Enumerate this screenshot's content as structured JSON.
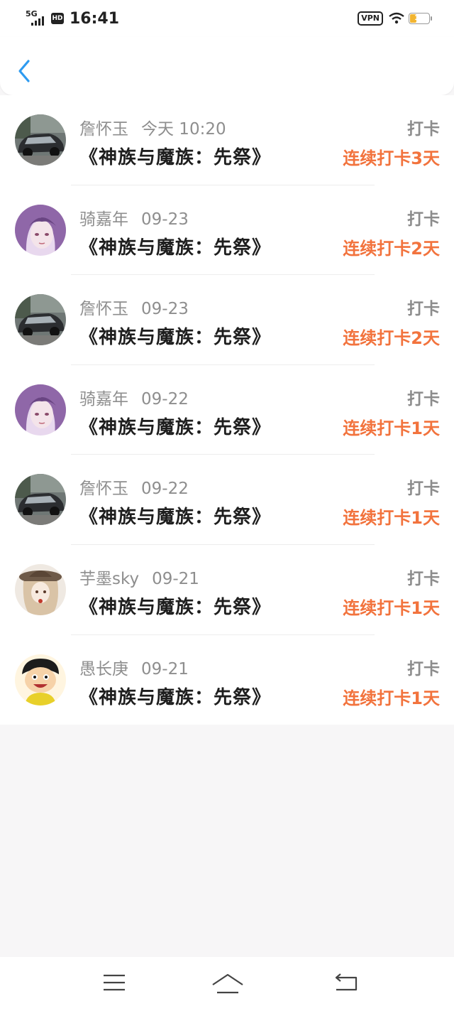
{
  "status_bar": {
    "network": "5G",
    "hd": "HD",
    "time": "16:41",
    "vpn": "VPN",
    "battery": "15",
    "battery_level": 0.15
  },
  "header": {
    "back_icon": "chevron-left-icon",
    "accent": "#2e9bf0"
  },
  "colors": {
    "streak": "#f2733d",
    "name": "#8e8e8e",
    "title": "#1e1e1e"
  },
  "entries": [
    {
      "user": "詹怀玉",
      "date": "今天 10:20",
      "title": "《神族与魔族：先祭》",
      "type": "打卡",
      "streak": "连续打卡3天",
      "avatar": "car-photo"
    },
    {
      "user": "骑嘉年",
      "date": "09-23",
      "title": "《神族与魔族：先祭》",
      "type": "打卡",
      "streak": "连续打卡2天",
      "avatar": "anime-girl"
    },
    {
      "user": "詹怀玉",
      "date": "09-23",
      "title": "《神族与魔族：先祭》",
      "type": "打卡",
      "streak": "连续打卡2天",
      "avatar": "car-photo"
    },
    {
      "user": "骑嘉年",
      "date": "09-22",
      "title": "《神族与魔族：先祭》",
      "type": "打卡",
      "streak": "连续打卡1天",
      "avatar": "anime-girl"
    },
    {
      "user": "詹怀玉",
      "date": "09-22",
      "title": "《神族与魔族：先祭》",
      "type": "打卡",
      "streak": "连续打卡1天",
      "avatar": "car-photo"
    },
    {
      "user": "芋墨sky",
      "date": "09-21",
      "title": "《神族与魔族：先祭》",
      "type": "打卡",
      "streak": "连续打卡1天",
      "avatar": "hat-girl"
    },
    {
      "user": "愚长庚",
      "date": "09-21",
      "title": "《神族与魔族：先祭》",
      "type": "打卡",
      "streak": "连续打卡1天",
      "avatar": "cartoon-boy"
    }
  ],
  "bottom_nav": {
    "menu_icon": "menu-icon",
    "home_icon": "home-icon",
    "back_icon": "return-icon"
  }
}
